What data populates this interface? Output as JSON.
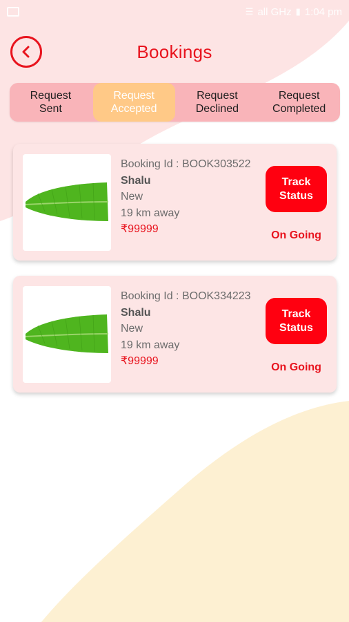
{
  "status_bar": {
    "time": "1:04 pm",
    "signal": "all GHz"
  },
  "header": {
    "title": "Bookings"
  },
  "tabs": [
    {
      "label": "Request\nSent",
      "active": false
    },
    {
      "label": "Request\nAccepted",
      "active": true
    },
    {
      "label": "Request\nDeclined",
      "active": false
    },
    {
      "label": "Request\nCompleted",
      "active": false
    }
  ],
  "bookings": [
    {
      "booking_label": "Booking Id :  BOOK303522",
      "name": "Shalu",
      "condition": "New",
      "distance": "19 km away",
      "price": "₹99999",
      "track_label": "Track\nStatus",
      "status": "On Going",
      "image_icon": "banana-leaf-image"
    },
    {
      "booking_label": "Booking Id :  BOOK334223",
      "name": "Shalu",
      "condition": "New",
      "distance": "19 km away",
      "price": "₹99999",
      "track_label": "Track\nStatus",
      "status": "On Going",
      "image_icon": "banana-leaf-image"
    }
  ],
  "colors": {
    "accent": "#e8141e",
    "tab_bg": "#f9b4b9",
    "tab_active": "#ffc987",
    "card_bg": "#fde5e5",
    "button": "#ff0010",
    "bg_pink": "#fde4e4",
    "bg_cream": "#fdf0d2"
  }
}
